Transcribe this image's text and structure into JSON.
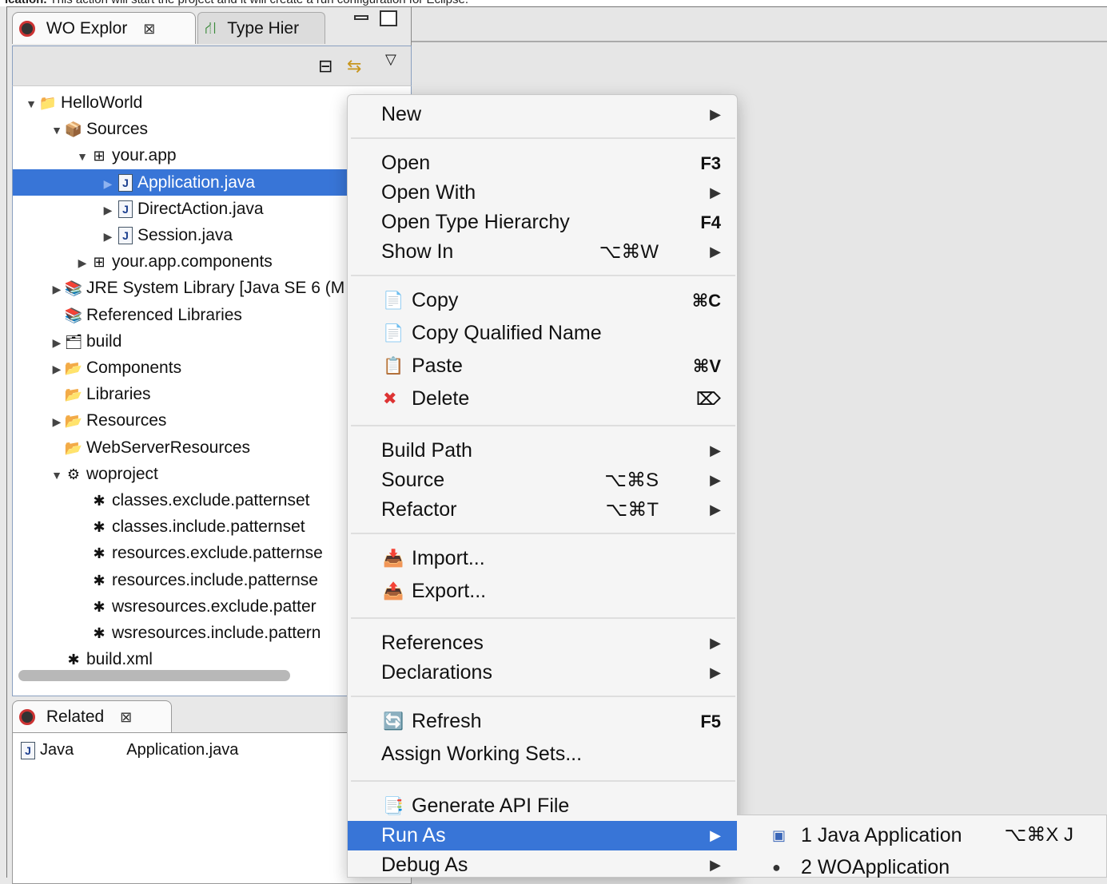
{
  "caption": {
    "bold": "ication.",
    "rest": " This action will start the project and it will create a run configuration for Eclipse."
  },
  "explorer": {
    "tabs": [
      {
        "label": "WO Explor"
      },
      {
        "label": "Type Hier"
      }
    ],
    "tree": [
      {
        "label": "HelloWorld",
        "depth": 0,
        "twisty": "▼",
        "icon": "📁"
      },
      {
        "label": "Sources",
        "depth": 1,
        "twisty": "▼",
        "icon": "📦"
      },
      {
        "label": "your.app",
        "depth": 2,
        "twisty": "▼",
        "icon": "⊞"
      },
      {
        "label": "Application.java",
        "depth": 3,
        "twisty": "▶",
        "icon": "J",
        "selected": true
      },
      {
        "label": "DirectAction.java",
        "depth": 3,
        "twisty": "▶",
        "icon": "J"
      },
      {
        "label": "Session.java",
        "depth": 3,
        "twisty": "▶",
        "icon": "J"
      },
      {
        "label": "your.app.components",
        "depth": 2,
        "twisty": "▶",
        "icon": "⊞"
      },
      {
        "label": "JRE System Library [Java SE 6 (M",
        "depth": 1,
        "twisty": "▶",
        "icon": "📚"
      },
      {
        "label": "Referenced Libraries",
        "depth": 1,
        "twisty": "",
        "icon": "📚"
      },
      {
        "label": "build",
        "depth": 1,
        "twisty": "▶",
        "icon": "🗂"
      },
      {
        "label": "Components",
        "depth": 1,
        "twisty": "▶",
        "icon": "📂"
      },
      {
        "label": "Libraries",
        "depth": 1,
        "twisty": "",
        "icon": "📂"
      },
      {
        "label": "Resources",
        "depth": 1,
        "twisty": "▶",
        "icon": "📂"
      },
      {
        "label": "WebServerResources",
        "depth": 1,
        "twisty": "",
        "icon": "📂"
      },
      {
        "label": "woproject",
        "depth": 1,
        "twisty": "▼",
        "icon": "⚙"
      },
      {
        "label": "classes.exclude.patternset",
        "depth": 2,
        "twisty": "",
        "icon": "✱"
      },
      {
        "label": "classes.include.patternset",
        "depth": 2,
        "twisty": "",
        "icon": "✱"
      },
      {
        "label": "resources.exclude.patternse",
        "depth": 2,
        "twisty": "",
        "icon": "✱"
      },
      {
        "label": "resources.include.patternse",
        "depth": 2,
        "twisty": "",
        "icon": "✱"
      },
      {
        "label": "wsresources.exclude.patter",
        "depth": 2,
        "twisty": "",
        "icon": "✱"
      },
      {
        "label": "wsresources.include.pattern",
        "depth": 2,
        "twisty": "",
        "icon": "✱"
      },
      {
        "label": "build.xml",
        "depth": 1,
        "twisty": "",
        "icon": "✱"
      }
    ]
  },
  "related": {
    "tab": "Related",
    "row": {
      "kind": "Java",
      "file": "Application.java"
    }
  },
  "menu": {
    "items": [
      {
        "label": "New",
        "arrow": "▶"
      },
      {
        "sep": true
      },
      {
        "label": "Open",
        "shortcut": "F3"
      },
      {
        "label": "Open With",
        "arrow": "▶"
      },
      {
        "label": "Open Type Hierarchy",
        "shortcut": "F4"
      },
      {
        "label": "Show In",
        "keys": "⌥⌘W",
        "arrow": "▶"
      },
      {
        "sep": true
      },
      {
        "label": "Copy",
        "icon": "📄",
        "shortcut": "⌘C"
      },
      {
        "label": "Copy Qualified Name",
        "icon": "📄"
      },
      {
        "label": "Paste",
        "icon": "📋",
        "shortcut": "⌘V"
      },
      {
        "label": "Delete",
        "icon": "✖",
        "shortcut": "⌦"
      },
      {
        "sep": true
      },
      {
        "label": "Build Path",
        "arrow": "▶"
      },
      {
        "label": "Source",
        "keys": "⌥⌘S",
        "arrow": "▶"
      },
      {
        "label": "Refactor",
        "keys": "⌥⌘T",
        "arrow": "▶"
      },
      {
        "sep": true
      },
      {
        "label": "Import...",
        "icon": "📥"
      },
      {
        "label": "Export...",
        "icon": "📤"
      },
      {
        "sep": true
      },
      {
        "label": "References",
        "arrow": "▶"
      },
      {
        "label": "Declarations",
        "arrow": "▶"
      },
      {
        "sep": true
      },
      {
        "label": "Refresh",
        "icon": "🔄",
        "shortcut": "F5"
      },
      {
        "label": "Assign Working Sets..."
      },
      {
        "sep": true
      },
      {
        "label": "Generate API File",
        "icon": "📑"
      },
      {
        "label": "Run As",
        "arrow": "▶",
        "highlighted": true
      },
      {
        "label": "Debug As",
        "arrow": "▶"
      }
    ]
  },
  "submenu": {
    "items": [
      {
        "label": "1 Java Application",
        "keys": "⌥⌘X J",
        "icon": "▣"
      },
      {
        "label": "2 WOApplication",
        "icon": "●"
      }
    ]
  },
  "colors": {
    "selection": "#3875d7",
    "menu_bg": "#f5f5f5"
  }
}
